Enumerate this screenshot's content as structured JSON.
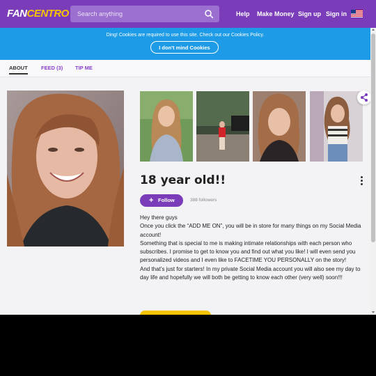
{
  "header": {
    "logo_prefix": "FAN",
    "logo_suffix": "CENTRO",
    "search_placeholder": "Search anything",
    "nav": [
      "Help",
      "Make Money",
      "Sign up",
      "Sign in"
    ]
  },
  "cookie": {
    "text": "Ding! Cookies are required to use this site. Check out our Cookies Policy.",
    "button": "I don't mind Cookies"
  },
  "tabs": [
    {
      "label": "ABOUT",
      "active": true
    },
    {
      "label": "FEED (3)",
      "active": false
    },
    {
      "label": "TIP ME",
      "active": false
    }
  ],
  "profile": {
    "title": "18 year old!!",
    "follow_label": "Follow",
    "followers": "388 followers",
    "bio": [
      "Hey there guys",
      "Once you click the “ADD ME ON”, you will be in store for many things on my Social Media account!",
      "Something that is special to me is making intimate relationships with each person who subscribes. I promise to get to know you and find out what you like! I will even send you personalized videos and I even like to FACETIME YOU PERSONALLY on the story!",
      "And that’s just for starters! In my private Social Media account you will also see my day to day life and hopefully we will both be getting to know each other (very well) soon!!!"
    ]
  },
  "colors": {
    "brand_purple": "#7a3cb8",
    "cookie_blue": "#1d9be6",
    "accent_yellow": "#f6c400"
  }
}
